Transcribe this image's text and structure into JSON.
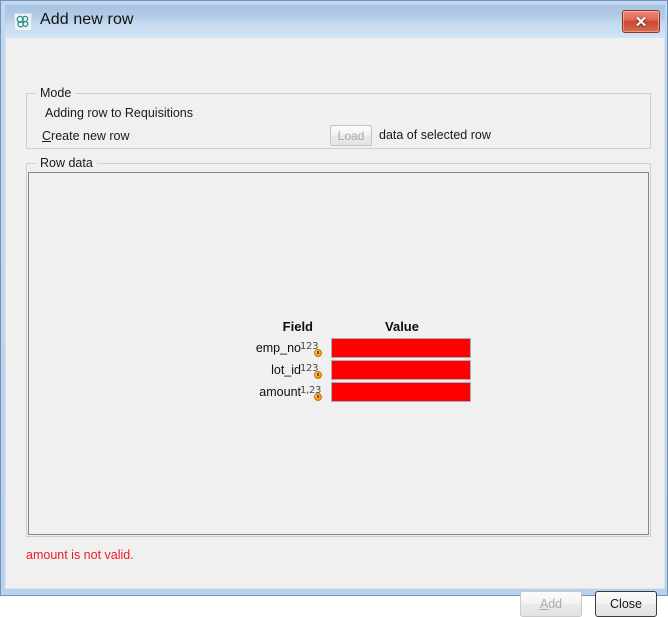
{
  "window": {
    "title": "Add new row",
    "icon": "app-molecule-icon",
    "close_label": "✕"
  },
  "mode": {
    "group_title": "Mode",
    "status_line": "Adding row to Requisitions",
    "create_prefix": "C",
    "create_rest": "reate new row",
    "create_full": "Create new row",
    "load_button": "Load",
    "load_suffix": "data of selected row"
  },
  "row_data": {
    "group_title": "Row data",
    "headers": {
      "field": "Field",
      "value": "Value"
    },
    "fields": [
      {
        "name": "emp_no",
        "type_glyph": "123",
        "value": "",
        "invalid": true
      },
      {
        "name": "lot_id",
        "type_glyph": "123",
        "value": "",
        "invalid": true
      },
      {
        "name": "amount",
        "type_glyph": "1,23",
        "value": "",
        "invalid": true
      }
    ]
  },
  "status": {
    "error_message": "amount is not valid.",
    "error_color": "#ee1c25"
  },
  "footer": {
    "add_prefix": "A",
    "add_rest": "dd",
    "add_label": "Add",
    "close_label": "Close"
  },
  "colors": {
    "invalid_field": "#ff0000",
    "titlebar_top": "#a8c3e0",
    "titlebar_bottom": "#d4e5f6",
    "client_bg": "#f0f0f0",
    "close_button": "#cf4632"
  }
}
